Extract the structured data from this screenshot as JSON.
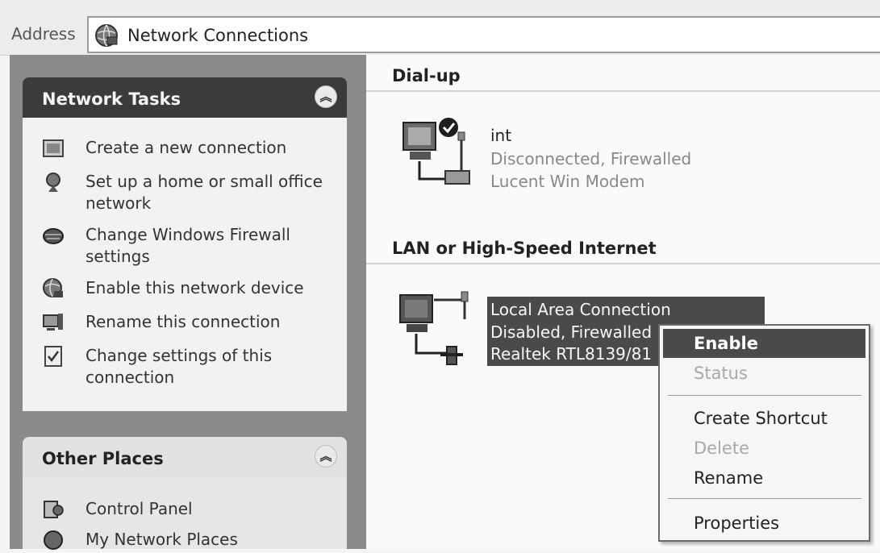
{
  "address_bar": {
    "label": "Address",
    "value": "Network Connections",
    "icon": "network-globe-icon"
  },
  "network_tasks": {
    "title": "Network Tasks",
    "items": [
      {
        "label": "Create a new connection",
        "icon": "new-connection-icon"
      },
      {
        "label": "Set up a home or small office network",
        "icon": "home-network-icon"
      },
      {
        "label": "Change Windows Firewall settings",
        "icon": "firewall-icon"
      },
      {
        "label": "Enable this network device",
        "icon": "enable-device-icon"
      },
      {
        "label": "Rename this connection",
        "icon": "rename-icon"
      },
      {
        "label": "Change settings of this connection",
        "icon": "settings-icon"
      }
    ]
  },
  "other_places": {
    "title": "Other Places",
    "items": [
      {
        "label": "Control Panel",
        "icon": "control-panel-icon"
      },
      {
        "label": "My Network Places",
        "icon": "network-places-icon"
      }
    ]
  },
  "groups": [
    {
      "title": "Dial-up",
      "connections": [
        {
          "name": "int",
          "status": "Disconnected, Firewalled",
          "device": "Lucent Win Modem"
        }
      ]
    },
    {
      "title": "LAN or High-Speed Internet",
      "connections": [
        {
          "name": "Local Area Connection",
          "status": "Disabled, Firewalled",
          "device": "Realtek RTL8139/81"
        }
      ]
    }
  ],
  "context_menu": {
    "items": [
      {
        "label": "Enable",
        "state": "default"
      },
      {
        "label": "Status",
        "state": "disabled"
      },
      {
        "label": "Create Shortcut",
        "state": "enabled"
      },
      {
        "label": "Delete",
        "state": "disabled"
      },
      {
        "label": "Rename",
        "state": "enabled"
      },
      {
        "label": "Properties",
        "state": "enabled"
      }
    ]
  }
}
